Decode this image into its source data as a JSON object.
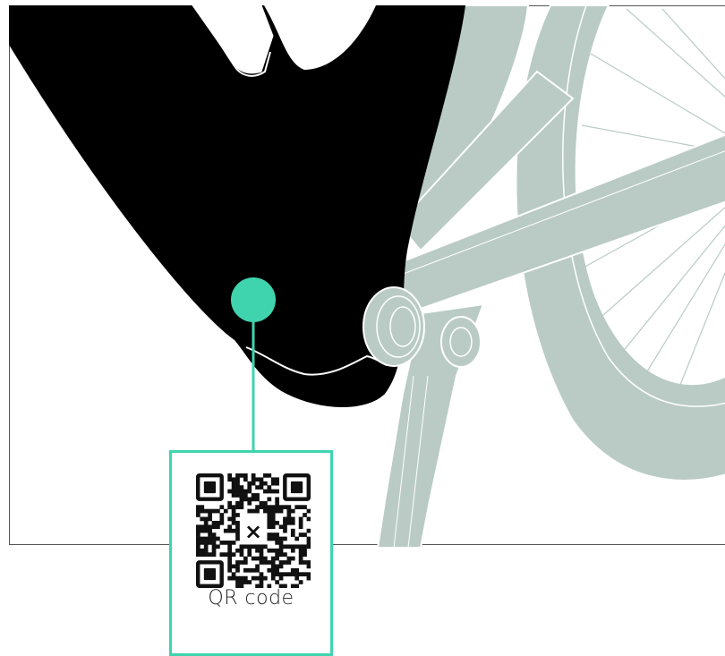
{
  "callout": {
    "label": "QR code",
    "icon": "qr-code-icon",
    "center_mark": "×"
  },
  "colors": {
    "frame": "#000000",
    "bike_part": "#b9cbc4",
    "accent": "#3fd4ad",
    "outline": "#ffffff",
    "border": "#555555"
  }
}
